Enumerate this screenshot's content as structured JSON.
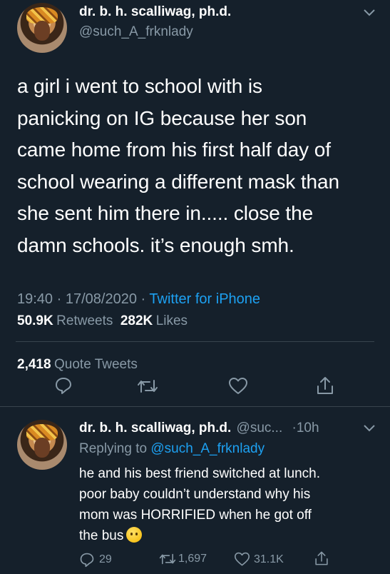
{
  "main_tweet": {
    "display_name": "dr. b. h. scalliwag, ph.d.",
    "handle": "@such_A_frknlady",
    "text_lines": [
      "a girl i went to school with is",
      "panicking on IG because her son",
      "came home from his first half day of",
      "school wearing a different mask than",
      "she sent him there in..... close the",
      "damn schools. it’s enough smh."
    ],
    "time": "19:40",
    "date": "17/08/2020",
    "sep": "·",
    "client": "Twitter for iPhone",
    "retweets_count": "50.9K",
    "retweets_label": "Retweets",
    "likes_count": "282K",
    "likes_label": "Likes",
    "quote_count": "2,418",
    "quote_label": "Quote Tweets"
  },
  "reply_tweet": {
    "display_name": "dr. b. h. scalliwag, ph.d.",
    "handle": "@suc...",
    "age": "·10h",
    "replying_prefix": "Replying to",
    "replying_handle": "@such_A_frknlady",
    "text_lines": [
      "he and his best friend switched at lunch.",
      "poor baby couldn’t understand why his",
      "mom was HORRIFIED when he got off",
      "the bus"
    ],
    "emoji": "woozy-face",
    "reply_count": "29",
    "retweet_count": "1,697",
    "like_count": "31.1K"
  },
  "icons": {
    "more": "chevron-down-icon",
    "reply": "reply-icon",
    "retweet": "retweet-icon",
    "like": "heart-icon",
    "share": "share-icon"
  },
  "colors": {
    "background": "#15202b",
    "secondary_text": "#8899a6",
    "link": "#1da1f2",
    "divider": "#38444d"
  }
}
